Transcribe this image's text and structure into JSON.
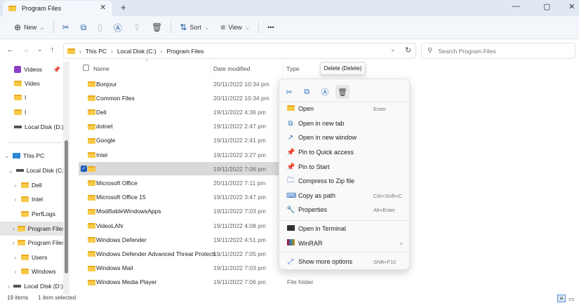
{
  "window": {
    "tab_title": "Program Files",
    "minimize": "—",
    "maximize": "▢",
    "close": "✕"
  },
  "toolbar": {
    "new_label": "New",
    "sort_label": "Sort",
    "view_label": "View",
    "more": "•••"
  },
  "address": {
    "segments": [
      "This PC",
      "Local Disk (C:)",
      "Program Files"
    ],
    "search_placeholder": "Search Program Files"
  },
  "sidebar": {
    "items": [
      {
        "label": "Videos",
        "icon": "videos",
        "indent": 0,
        "chev": "",
        "pin": true
      },
      {
        "label": "Video",
        "icon": "folder",
        "indent": 0,
        "chev": ""
      },
      {
        "label": "I",
        "icon": "folder",
        "indent": 0,
        "chev": ""
      },
      {
        "label": "I",
        "icon": "folder",
        "indent": 0,
        "chev": ""
      },
      {
        "label": "Local Disk (D:)",
        "icon": "drive",
        "indent": 0,
        "chev": ""
      },
      {
        "label": "This PC",
        "icon": "pc",
        "indent": -1,
        "chev": "⌄"
      },
      {
        "label": "Local Disk (C:)",
        "icon": "drive",
        "indent": 0,
        "chev": "⌄"
      },
      {
        "label": "Dell",
        "icon": "folder",
        "indent": 1,
        "chev": "›"
      },
      {
        "label": "Intel",
        "icon": "folder",
        "indent": 1,
        "chev": "›"
      },
      {
        "label": "PerfLogs",
        "icon": "folder",
        "indent": 1,
        "chev": ""
      },
      {
        "label": "Program Files",
        "icon": "folder",
        "indent": 1,
        "chev": "›",
        "selected": true
      },
      {
        "label": "Program Files",
        "icon": "folder",
        "indent": 1,
        "chev": "›"
      },
      {
        "label": "Users",
        "icon": "folder",
        "indent": 1,
        "chev": "›"
      },
      {
        "label": "Windows",
        "icon": "folder",
        "indent": 1,
        "chev": "›"
      },
      {
        "label": "Local Disk (D:)",
        "icon": "drive",
        "indent": -0.5,
        "chev": "›"
      }
    ]
  },
  "columns": {
    "name": "Name",
    "date": "Date modified",
    "type": "Type"
  },
  "files": [
    {
      "name": "Bonjour",
      "date": "20/11/2022 10:34 pm"
    },
    {
      "name": "Common Files",
      "date": "20/11/2022 10:34 pm"
    },
    {
      "name": "Dell",
      "date": "19/11/2022 4:36 pm"
    },
    {
      "name": "dotnet",
      "date": "19/11/2022 2:47 pm"
    },
    {
      "name": "Google",
      "date": "19/11/2022 2:41 pm"
    },
    {
      "name": "Intel",
      "date": "19/11/2022 3:27 pm"
    },
    {
      "name": "",
      "date": "19/11/2022 7:06 pm",
      "selected": true
    },
    {
      "name": "Microsoft Office",
      "date": "20/11/2022 7:11 pm"
    },
    {
      "name": "Microsoft Office 15",
      "date": "19/11/2022 3:47 pm"
    },
    {
      "name": "ModifiableWindowsApps",
      "date": "19/11/2022 7:03 pm"
    },
    {
      "name": "VideoLAN",
      "date": "19/11/2022 4:08 pm"
    },
    {
      "name": "Windows Defender",
      "date": "19/11/2022 4:51 pm"
    },
    {
      "name": "Windows Defender Advanced Threat Protecti...",
      "date": "19/11/2022 7:05 pm"
    },
    {
      "name": "Windows Mail",
      "date": "19/11/2022 7:03 pm"
    },
    {
      "name": "Windows Media Player",
      "date": "19/11/2022 7:06 pm"
    }
  ],
  "last_type": "File folder",
  "tooltip": "Delete (Delete)",
  "context_menu": {
    "items": [
      {
        "label": "Open",
        "shortcut": "Enter",
        "icon": "folder-open"
      },
      {
        "label": "Open in new tab",
        "shortcut": "",
        "icon": "new-tab"
      },
      {
        "label": "Open in new window",
        "shortcut": "",
        "icon": "new-window"
      },
      {
        "label": "Pin to Quick access",
        "shortcut": "",
        "icon": "pin"
      },
      {
        "label": "Pin to Start",
        "shortcut": "",
        "icon": "pin"
      },
      {
        "label": "Compress to Zip file",
        "shortcut": "",
        "icon": "zip"
      },
      {
        "label": "Copy as path",
        "shortcut": "Ctrl+Shift+C",
        "icon": "path"
      },
      {
        "label": "Properties",
        "shortcut": "Alt+Enter",
        "icon": "wrench"
      },
      {
        "label": "Open in Terminal",
        "shortcut": "",
        "icon": "terminal"
      },
      {
        "label": "WinRAR",
        "shortcut": "›",
        "icon": "winrar"
      },
      {
        "label": "Show more options",
        "shortcut": "Shift+F10",
        "icon": "more-options"
      }
    ]
  },
  "status": {
    "count": "19 items",
    "selected": "1 item selected"
  }
}
